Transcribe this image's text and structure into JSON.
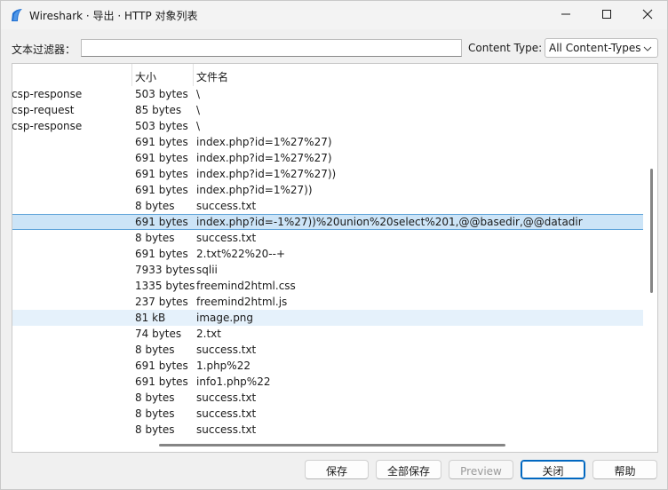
{
  "window": {
    "title": "Wireshark · 导出 · HTTP 对象列表"
  },
  "filter": {
    "label": "文本过滤器：",
    "value": ""
  },
  "content_type": {
    "label": "Content Type:",
    "selected": "All Content-Types"
  },
  "table": {
    "columns": [
      "大小",
      "文件名"
    ],
    "rows": [
      {
        "type": "csp-response",
        "size": "503 bytes",
        "name": "\\"
      },
      {
        "type": "csp-request",
        "size": "85 bytes",
        "name": "\\"
      },
      {
        "type": "csp-response",
        "size": "503 bytes",
        "name": "\\"
      },
      {
        "type": "",
        "size": "691 bytes",
        "name": "index.php?id=1%27%27)"
      },
      {
        "type": "",
        "size": "691 bytes",
        "name": "index.php?id=1%27%27)"
      },
      {
        "type": "",
        "size": "691 bytes",
        "name": "index.php?id=1%27%27))"
      },
      {
        "type": "",
        "size": "691 bytes",
        "name": "index.php?id=1%27))"
      },
      {
        "type": "",
        "size": "8 bytes",
        "name": "success.txt"
      },
      {
        "type": "",
        "size": "691 bytes",
        "name": "index.php?id=-1%27))%20union%20select%201,@@basedir,@@datadir"
      },
      {
        "type": "",
        "size": "8 bytes",
        "name": "success.txt"
      },
      {
        "type": "",
        "size": "691 bytes",
        "name": "2.txt%22%20--+"
      },
      {
        "type": "",
        "size": "7933 bytes",
        "name": "sqlii"
      },
      {
        "type": "",
        "size": "1335 bytes",
        "name": "freemind2html.css"
      },
      {
        "type": "",
        "size": "237 bytes",
        "name": "freemind2html.js"
      },
      {
        "type": "",
        "size": "81 kB",
        "name": "image.png"
      },
      {
        "type": "",
        "size": "74 bytes",
        "name": "2.txt"
      },
      {
        "type": "",
        "size": "8 bytes",
        "name": "success.txt"
      },
      {
        "type": "",
        "size": "691 bytes",
        "name": "1.php%22"
      },
      {
        "type": "",
        "size": "691 bytes",
        "name": "info1.php%22"
      },
      {
        "type": "",
        "size": "8 bytes",
        "name": "success.txt"
      },
      {
        "type": "",
        "size": "8 bytes",
        "name": "success.txt"
      },
      {
        "type": "",
        "size": "8 bytes",
        "name": "success.txt"
      }
    ],
    "selected_row": 8,
    "hover_row": 14
  },
  "buttons": {
    "save": "保存",
    "save_all": "全部保存",
    "preview": "Preview",
    "close": "关闭",
    "help": "帮助"
  },
  "colors": {
    "selection": "#cce4f7",
    "hover": "#e5f1fb",
    "accent": "#0067c0"
  }
}
